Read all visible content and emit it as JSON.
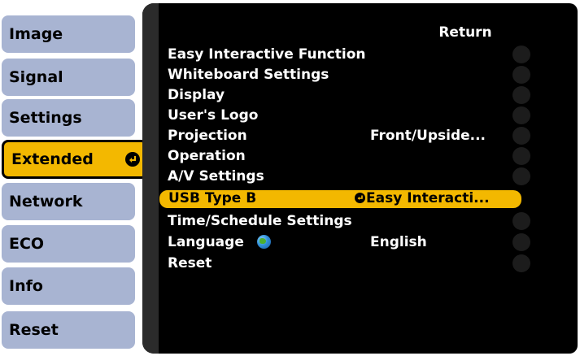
{
  "sidebar": {
    "items": [
      {
        "label": "Image"
      },
      {
        "label": "Signal"
      },
      {
        "label": "Settings"
      },
      {
        "label": "Extended"
      },
      {
        "label": "Network"
      },
      {
        "label": "ECO"
      },
      {
        "label": "Info"
      },
      {
        "label": "Reset"
      }
    ],
    "active_index": 3
  },
  "panel": {
    "return_label": "Return",
    "rows": [
      {
        "label": "Easy Interactive Function",
        "value": ""
      },
      {
        "label": "Whiteboard Settings",
        "value": ""
      },
      {
        "label": "Display",
        "value": ""
      },
      {
        "label": "User's Logo",
        "value": ""
      },
      {
        "label": "Projection",
        "value": "Front/Upside..."
      },
      {
        "label": "Operation",
        "value": ""
      },
      {
        "label": "A/V Settings",
        "value": ""
      },
      {
        "label": "USB Type B",
        "value": "Easy Interacti..."
      },
      {
        "label": "Time/Schedule Settings",
        "value": ""
      },
      {
        "label": "Language",
        "value": "English"
      },
      {
        "label": "Reset",
        "value": ""
      }
    ],
    "selected_index": 7
  },
  "icons": {
    "enter": "enter-icon",
    "globe": "globe-icon"
  },
  "colors": {
    "tab_inactive": "#a8b4d2",
    "tab_active": "#f3b800",
    "panel_bg": "#000000",
    "row_selected": "#f3b800"
  }
}
